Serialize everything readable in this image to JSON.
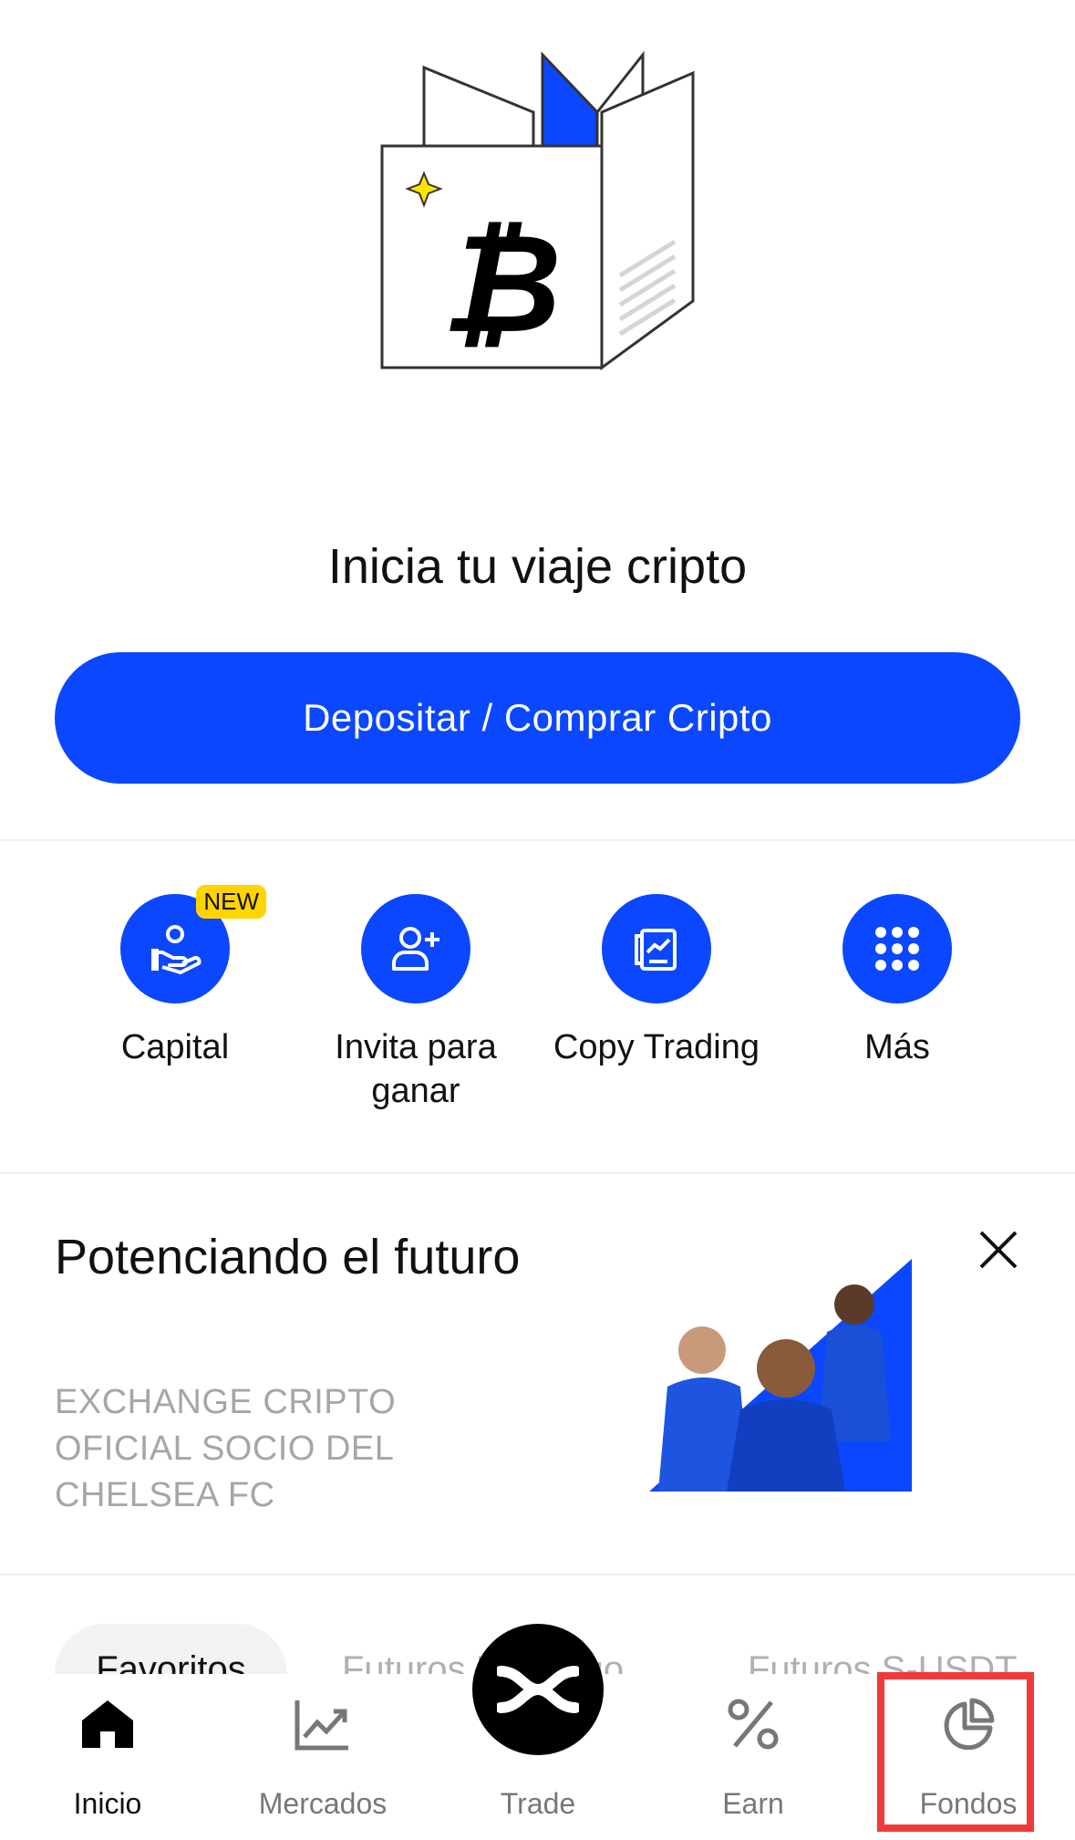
{
  "hero": {
    "title": "Inicia tu viaje cripto",
    "cta_label": "Depositar / Comprar Cripto"
  },
  "quick_actions": [
    {
      "label": "Capital",
      "icon": "hand-coin-icon",
      "badge": "NEW"
    },
    {
      "label": "Invita para ganar",
      "icon": "add-user-icon"
    },
    {
      "label": "Copy Trading",
      "icon": "copy-trading-icon"
    },
    {
      "label": "Más",
      "icon": "grid-dots-icon"
    }
  ],
  "promo": {
    "title": "Potenciando el futuro",
    "subtitle": "EXCHANGE CRIPTO OFICIAL SOCIO DEL CHELSEA FC"
  },
  "tabs": [
    {
      "label": "Favoritos",
      "active": true
    },
    {
      "label": "Futuros Perpetuo"
    },
    {
      "label": "Futuros S-USDT"
    }
  ],
  "bottom_nav": [
    {
      "label": "Inicio",
      "icon": "home-icon",
      "active": true
    },
    {
      "label": "Mercados",
      "icon": "chart-icon"
    },
    {
      "label": "Trade",
      "icon": "trade-logo-icon"
    },
    {
      "label": "Earn",
      "icon": "percent-icon"
    },
    {
      "label": "Fondos",
      "icon": "pie-chart-icon",
      "highlighted": true
    }
  ],
  "colors": {
    "accent": "#0a47ff",
    "badge": "#ffd400",
    "highlight": "#f03a3a"
  }
}
